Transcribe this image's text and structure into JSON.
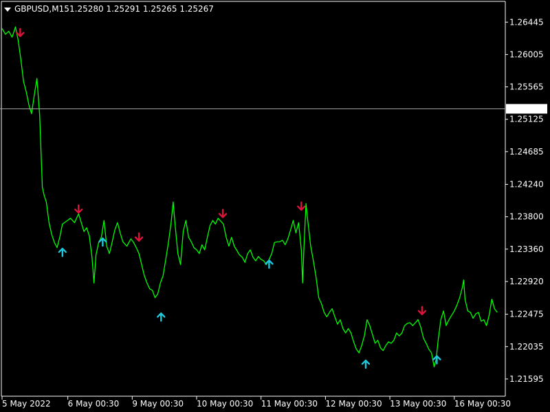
{
  "header": {
    "symbol_timeframe": "GBPUSD,M15",
    "ohlc": "1.25280 1.25291 1.25265 1.25267",
    "menu_icon": "triangle-down-icon"
  },
  "colors": {
    "background": "#000000",
    "price_line": "#00ff00",
    "sell_arrow": "#dc143c",
    "buy_arrow": "#1ec8dc",
    "axis": "#ffffff",
    "current_price_line": "#a0a0a0",
    "price_label_bg": "#ffffff",
    "price_label_text": "#000000"
  },
  "chart_data": {
    "type": "line",
    "symbol": "GBPUSD",
    "timeframe": "M15",
    "current_price": "1.25267",
    "ylim": [
      1.2137,
      1.2669
    ],
    "xlim": [
      0,
      747
    ],
    "y_ticks": [
      "1.26445",
      "1.26005",
      "1.25565",
      "1.25125",
      "1.24685",
      "1.24240",
      "1.23800",
      "1.23360",
      "1.22920",
      "1.22475",
      "1.22035",
      "1.21595"
    ],
    "x_ticks": [
      {
        "label": "5 May 2022",
        "x": 0
      },
      {
        "label": "6 May 00:30",
        "x": 98
      },
      {
        "label": "9 May 00:30",
        "x": 194
      },
      {
        "label": "10 May 00:30",
        "x": 290
      },
      {
        "label": "11 May 00:30",
        "x": 386
      },
      {
        "label": "12 May 00:30",
        "x": 482
      },
      {
        "label": "13 May 00:30",
        "x": 578
      },
      {
        "label": "16 May 00:30",
        "x": 674
      }
    ],
    "series": [
      {
        "points": [
          [
            0,
            1.2636
          ],
          [
            5,
            1.2628
          ],
          [
            10,
            1.2632
          ],
          [
            15,
            1.2624
          ],
          [
            20,
            1.2638
          ],
          [
            24,
            1.262
          ],
          [
            28,
            1.2594
          ],
          [
            32,
            1.2564
          ],
          [
            36,
            1.255
          ],
          [
            40,
            1.2532
          ],
          [
            44,
            1.252
          ],
          [
            48,
            1.2545
          ],
          [
            52,
            1.2568
          ],
          [
            56,
            1.2518
          ],
          [
            58,
            1.247
          ],
          [
            60,
            1.242
          ],
          [
            63,
            1.2408
          ],
          [
            66,
            1.24
          ],
          [
            70,
            1.2372
          ],
          [
            74,
            1.2356
          ],
          [
            78,
            1.2345
          ],
          [
            82,
            1.2338
          ],
          [
            86,
            1.2352
          ],
          [
            90,
            1.237
          ],
          [
            96,
            1.2374
          ],
          [
            102,
            1.2378
          ],
          [
            108,
            1.2372
          ],
          [
            114,
            1.2384
          ],
          [
            118,
            1.2372
          ],
          [
            122,
            1.236
          ],
          [
            126,
            1.2365
          ],
          [
            130,
            1.2354
          ],
          [
            134,
            1.2325
          ],
          [
            137,
            1.229
          ],
          [
            140,
            1.2328
          ],
          [
            144,
            1.2345
          ],
          [
            148,
            1.2352
          ],
          [
            152,
            1.2375
          ],
          [
            156,
            1.234
          ],
          [
            160,
            1.233
          ],
          [
            164,
            1.2345
          ],
          [
            168,
            1.2362
          ],
          [
            172,
            1.2372
          ],
          [
            176,
            1.2358
          ],
          [
            180,
            1.2346
          ],
          [
            186,
            1.234
          ],
          [
            192,
            1.235
          ],
          [
            196,
            1.2345
          ],
          [
            200,
            1.2338
          ],
          [
            204,
            1.233
          ],
          [
            208,
            1.2315
          ],
          [
            212,
            1.23
          ],
          [
            216,
            1.229
          ],
          [
            220,
            1.2282
          ],
          [
            224,
            1.228
          ],
          [
            228,
            1.227
          ],
          [
            232,
            1.2275
          ],
          [
            236,
            1.229
          ],
          [
            240,
            1.23
          ],
          [
            244,
            1.2322
          ],
          [
            248,
            1.2345
          ],
          [
            252,
            1.2372
          ],
          [
            255,
            1.24
          ],
          [
            258,
            1.2368
          ],
          [
            262,
            1.233
          ],
          [
            266,
            1.2315
          ],
          [
            270,
            1.236
          ],
          [
            274,
            1.2375
          ],
          [
            278,
            1.2352
          ],
          [
            282,
            1.2346
          ],
          [
            286,
            1.2338
          ],
          [
            290,
            1.2335
          ],
          [
            294,
            1.233
          ],
          [
            298,
            1.2342
          ],
          [
            302,
            1.2335
          ],
          [
            306,
            1.2352
          ],
          [
            310,
            1.2368
          ],
          [
            314,
            1.2375
          ],
          [
            318,
            1.237
          ],
          [
            322,
            1.2378
          ],
          [
            326,
            1.2374
          ],
          [
            330,
            1.237
          ],
          [
            334,
            1.2352
          ],
          [
            338,
            1.234
          ],
          [
            342,
            1.2352
          ],
          [
            346,
            1.234
          ],
          [
            350,
            1.2334
          ],
          [
            354,
            1.2328
          ],
          [
            358,
            1.2325
          ],
          [
            362,
            1.2318
          ],
          [
            366,
            1.233
          ],
          [
            370,
            1.2335
          ],
          [
            374,
            1.2325
          ],
          [
            378,
            1.232
          ],
          [
            382,
            1.2326
          ],
          [
            386,
            1.2322
          ],
          [
            390,
            1.232
          ],
          [
            394,
            1.2315
          ],
          [
            398,
            1.2322
          ],
          [
            402,
            1.233
          ],
          [
            406,
            1.2345
          ],
          [
            410,
            1.2346
          ],
          [
            414,
            1.2346
          ],
          [
            418,
            1.2348
          ],
          [
            422,
            1.2342
          ],
          [
            426,
            1.235
          ],
          [
            430,
            1.2362
          ],
          [
            434,
            1.2375
          ],
          [
            438,
            1.2358
          ],
          [
            442,
            1.2372
          ],
          [
            446,
            1.2335
          ],
          [
            448,
            1.229
          ],
          [
            450,
            1.234
          ],
          [
            453,
            1.2398
          ],
          [
            456,
            1.2372
          ],
          [
            460,
            1.234
          ],
          [
            464,
            1.232
          ],
          [
            468,
            1.2298
          ],
          [
            472,
            1.227
          ],
          [
            476,
            1.2262
          ],
          [
            480,
            1.225
          ],
          [
            484,
            1.2244
          ],
          [
            488,
            1.225
          ],
          [
            492,
            1.2255
          ],
          [
            496,
            1.2244
          ],
          [
            500,
            1.2234
          ],
          [
            504,
            1.224
          ],
          [
            508,
            1.2228
          ],
          [
            512,
            1.2222
          ],
          [
            516,
            1.2228
          ],
          [
            520,
            1.2222
          ],
          [
            524,
            1.221
          ],
          [
            528,
            1.22
          ],
          [
            532,
            1.2195
          ],
          [
            536,
            1.2205
          ],
          [
            540,
            1.2218
          ],
          [
            544,
            1.224
          ],
          [
            548,
            1.2232
          ],
          [
            552,
            1.222
          ],
          [
            556,
            1.2208
          ],
          [
            560,
            1.2212
          ],
          [
            564,
            1.2202
          ],
          [
            568,
            1.2198
          ],
          [
            572,
            1.2205
          ],
          [
            576,
            1.221
          ],
          [
            580,
            1.2208
          ],
          [
            584,
            1.2212
          ],
          [
            588,
            1.2222
          ],
          [
            592,
            1.2218
          ],
          [
            596,
            1.2222
          ],
          [
            600,
            1.2232
          ],
          [
            604,
            1.2235
          ],
          [
            608,
            1.2236
          ],
          [
            612,
            1.2232
          ],
          [
            616,
            1.2236
          ],
          [
            620,
            1.224
          ],
          [
            624,
            1.223
          ],
          [
            628,
            1.2215
          ],
          [
            632,
            1.2208
          ],
          [
            636,
            1.22
          ],
          [
            640,
            1.2195
          ],
          [
            644,
            1.2176
          ],
          [
            647,
            1.2186
          ],
          [
            650,
            1.2212
          ],
          [
            654,
            1.224
          ],
          [
            658,
            1.2252
          ],
          [
            662,
            1.2232
          ],
          [
            666,
            1.224
          ],
          [
            670,
            1.2246
          ],
          [
            674,
            1.2252
          ],
          [
            678,
            1.226
          ],
          [
            682,
            1.227
          ],
          [
            686,
            1.2284
          ],
          [
            688,
            1.2294
          ],
          [
            690,
            1.2268
          ],
          [
            694,
            1.2252
          ],
          [
            698,
            1.225
          ],
          [
            702,
            1.2242
          ],
          [
            706,
            1.2248
          ],
          [
            710,
            1.225
          ],
          [
            714,
            1.2238
          ],
          [
            718,
            1.224
          ],
          [
            722,
            1.2232
          ],
          [
            726,
            1.2246
          ],
          [
            730,
            1.2268
          ],
          [
            734,
            1.2255
          ],
          [
            738,
            1.225
          ]
        ]
      }
    ],
    "sell_signals": [
      [
        27,
        1.263
      ],
      [
        114,
        1.239
      ],
      [
        204,
        1.2352
      ],
      [
        329,
        1.2384
      ],
      [
        446,
        1.2394
      ],
      [
        626,
        1.2252
      ]
    ],
    "buy_signals": [
      [
        90,
        1.2332
      ],
      [
        150,
        1.2346
      ],
      [
        237,
        1.2244
      ],
      [
        398,
        1.2316
      ],
      [
        542,
        1.218
      ],
      [
        648,
        1.2186
      ]
    ]
  }
}
